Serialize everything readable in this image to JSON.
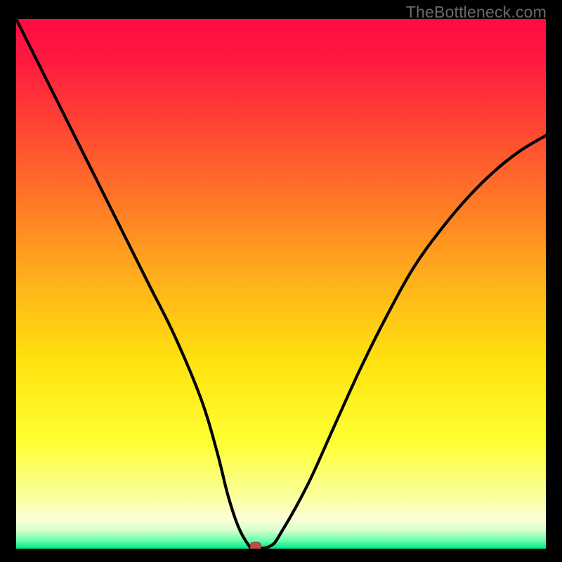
{
  "watermark": "TheBottleneck.com",
  "chart_data": {
    "type": "line",
    "title": "",
    "xlabel": "",
    "ylabel": "",
    "xlim": [
      0,
      100
    ],
    "ylim": [
      0,
      100
    ],
    "series": [
      {
        "name": "curve",
        "x": [
          0,
          5,
          10,
          15,
          20,
          25,
          30,
          35,
          38,
          40,
          42,
          44,
          45,
          48,
          50,
          55,
          60,
          65,
          70,
          75,
          80,
          85,
          90,
          95,
          100
        ],
        "y": [
          100,
          90,
          80,
          70,
          60,
          50,
          40,
          28,
          18,
          10,
          4,
          0.5,
          0,
          0.5,
          3,
          12,
          23,
          34,
          44,
          53,
          60,
          66,
          71,
          75,
          78
        ]
      }
    ],
    "marker": {
      "x": 45.2,
      "y": 0
    },
    "gradient_stops": [
      {
        "offset": 0.0,
        "color": "#ff0b44"
      },
      {
        "offset": 0.08,
        "color": "#ff1a3f"
      },
      {
        "offset": 0.2,
        "color": "#ff4433"
      },
      {
        "offset": 0.35,
        "color": "#ff7a26"
      },
      {
        "offset": 0.5,
        "color": "#ffb31a"
      },
      {
        "offset": 0.65,
        "color": "#ffe30f"
      },
      {
        "offset": 0.8,
        "color": "#ffff33"
      },
      {
        "offset": 0.9,
        "color": "#faff9a"
      },
      {
        "offset": 0.945,
        "color": "#fcffd8"
      },
      {
        "offset": 0.965,
        "color": "#d8ffcc"
      },
      {
        "offset": 0.985,
        "color": "#66ffaa"
      },
      {
        "offset": 1.0,
        "color": "#00e38a"
      }
    ]
  }
}
